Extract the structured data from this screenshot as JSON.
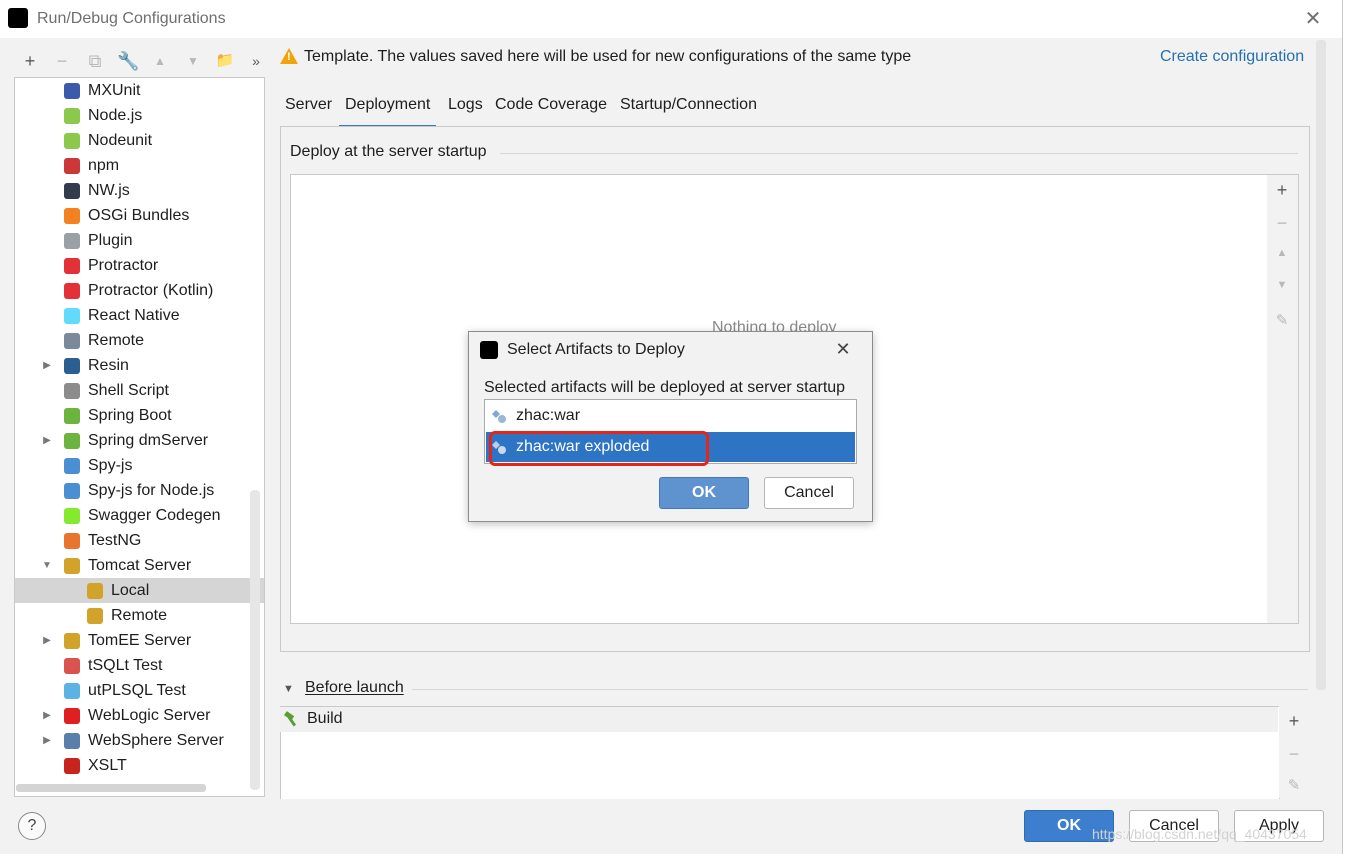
{
  "window": {
    "title": "Run/Debug Configurations"
  },
  "toolbar": {
    "buttons": [
      "+",
      "−",
      "⧉",
      "🔧",
      "▲",
      "▼",
      "📁",
      "»"
    ]
  },
  "tree": {
    "items": [
      {
        "label": "MXUnit",
        "icon": "mxunit-icon",
        "color": "#3b5ba9"
      },
      {
        "label": "Node.js",
        "icon": "nodejs-icon",
        "color": "#8cc84b"
      },
      {
        "label": "Nodeunit",
        "icon": "nodeunit-icon",
        "color": "#8cc84b"
      },
      {
        "label": "npm",
        "icon": "npm-icon",
        "color": "#cb3837"
      },
      {
        "label": "NW.js",
        "icon": "nwjs-icon",
        "color": "#333b4d"
      },
      {
        "label": "OSGi Bundles",
        "icon": "osgi-icon",
        "color": "#f58220"
      },
      {
        "label": "Plugin",
        "icon": "plugin-icon",
        "color": "#9aa0a6"
      },
      {
        "label": "Protractor",
        "icon": "protractor-icon",
        "color": "#e23237"
      },
      {
        "label": "Protractor (Kotlin)",
        "icon": "protractor-kotlin-icon",
        "color": "#e23237"
      },
      {
        "label": "React Native",
        "icon": "react-native-icon",
        "color": "#61dafb"
      },
      {
        "label": "Remote",
        "icon": "remote-icon",
        "color": "#7a8a99"
      },
      {
        "label": "Resin",
        "icon": "resin-icon",
        "color": "#2a5f8f",
        "expandable": true
      },
      {
        "label": "Shell Script",
        "icon": "shell-script-icon",
        "color": "#8c8c8c"
      },
      {
        "label": "Spring Boot",
        "icon": "spring-boot-icon",
        "color": "#6db33f"
      },
      {
        "label": "Spring dmServer",
        "icon": "spring-dmserver-icon",
        "color": "#6db33f",
        "expandable": true
      },
      {
        "label": "Spy-js",
        "icon": "spy-js-icon",
        "color": "#4b8fd3"
      },
      {
        "label": "Spy-js for Node.js",
        "icon": "spy-js-node-icon",
        "color": "#4b8fd3"
      },
      {
        "label": "Swagger Codegen",
        "icon": "swagger-icon",
        "color": "#85ea2d"
      },
      {
        "label": "TestNG",
        "icon": "testng-icon",
        "color": "#e8742e"
      },
      {
        "label": "Tomcat Server",
        "icon": "tomcat-icon",
        "color": "#d1a32b",
        "expanded": true
      },
      {
        "label": "Local",
        "icon": "tomcat-local-icon",
        "color": "#d1a32b",
        "child": true,
        "selected": true
      },
      {
        "label": "Remote",
        "icon": "tomcat-remote-icon",
        "color": "#d1a32b",
        "child": true
      },
      {
        "label": "TomEE Server",
        "icon": "tomee-icon",
        "color": "#d1a32b",
        "expandable": true
      },
      {
        "label": "tSQLt Test",
        "icon": "tsqlt-icon",
        "color": "#d9534f"
      },
      {
        "label": "utPLSQL Test",
        "icon": "utplsql-icon",
        "color": "#5bb3e4"
      },
      {
        "label": "WebLogic Server",
        "icon": "weblogic-icon",
        "color": "#e02020",
        "expandable": true
      },
      {
        "label": "WebSphere Server",
        "icon": "websphere-icon",
        "color": "#5a7fa8",
        "expandable": true
      },
      {
        "label": "XSLT",
        "icon": "xslt-icon",
        "color": "#c8241e"
      }
    ]
  },
  "banner": {
    "text": "Template. The values saved here will be used for new configurations of the same type",
    "link": "Create configuration"
  },
  "tabs": [
    {
      "label": "Server",
      "active": false
    },
    {
      "label": "Deployment",
      "active": true
    },
    {
      "label": "Logs",
      "active": false
    },
    {
      "label": "Code Coverage",
      "active": false
    },
    {
      "label": "Startup/Connection",
      "active": false
    }
  ],
  "deployment": {
    "section_title": "Deploy at the server startup",
    "empty_text": "Nothing to deploy"
  },
  "before_launch": {
    "title": "Before launch",
    "items": [
      "Build"
    ]
  },
  "footer": {
    "help": "?",
    "ok": "OK",
    "cancel": "Cancel",
    "apply": "Apply",
    "watermark": "https://blog.csdn.net/qq_40437054"
  },
  "dialog": {
    "title": "Select Artifacts to Deploy",
    "description": "Selected artifacts will be deployed at server startup",
    "artifacts": [
      {
        "label": "zhac:war",
        "selected": false
      },
      {
        "label": "zhac:war exploded",
        "selected": true
      }
    ],
    "ok": "OK",
    "cancel": "Cancel"
  }
}
